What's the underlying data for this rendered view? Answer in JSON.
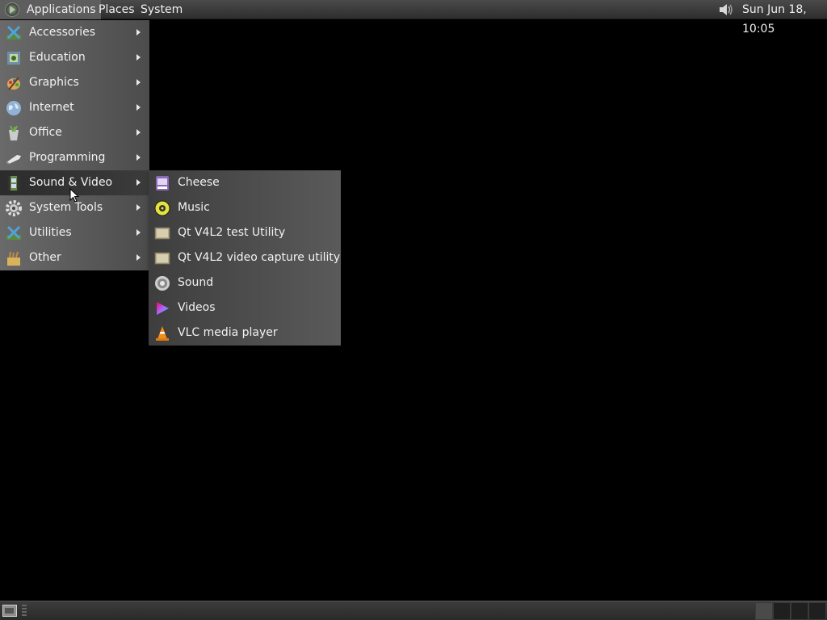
{
  "top_panel": {
    "menus": [
      "Applications",
      "Places",
      "System"
    ],
    "clock": "Sun Jun 18, 10:05",
    "volume_icon": "speaker-icon"
  },
  "applications_menu": {
    "items": [
      {
        "label": "Accessories",
        "icon": "accessories-icon"
      },
      {
        "label": "Education",
        "icon": "education-icon"
      },
      {
        "label": "Graphics",
        "icon": "graphics-icon"
      },
      {
        "label": "Internet",
        "icon": "globe-icon"
      },
      {
        "label": "Office",
        "icon": "office-icon"
      },
      {
        "label": "Programming",
        "icon": "programming-icon"
      },
      {
        "label": "Sound & Video",
        "icon": "film-strip-icon"
      },
      {
        "label": "System Tools",
        "icon": "gear-icon"
      },
      {
        "label": "Utilities",
        "icon": "utilities-icon"
      },
      {
        "label": "Other",
        "icon": "other-icon"
      }
    ],
    "active_index": 6
  },
  "sound_video_submenu": {
    "items": [
      {
        "label": "Cheese",
        "icon": "cheese-webcam-icon"
      },
      {
        "label": "Music",
        "icon": "music-disc-icon"
      },
      {
        "label": "Qt V4L2 test Utility",
        "icon": "qt-v4l2-icon"
      },
      {
        "label": "Qt V4L2 video capture utility",
        "icon": "qt-v4l2-icon"
      },
      {
        "label": "Sound",
        "icon": "sound-icon"
      },
      {
        "label": "Videos",
        "icon": "videos-play-icon"
      },
      {
        "label": "VLC media player",
        "icon": "vlc-cone-icon"
      }
    ]
  },
  "colors": {
    "panel": "#3a3a3a",
    "menu_bg": "#5a5a5a",
    "desktop": "#000000"
  }
}
